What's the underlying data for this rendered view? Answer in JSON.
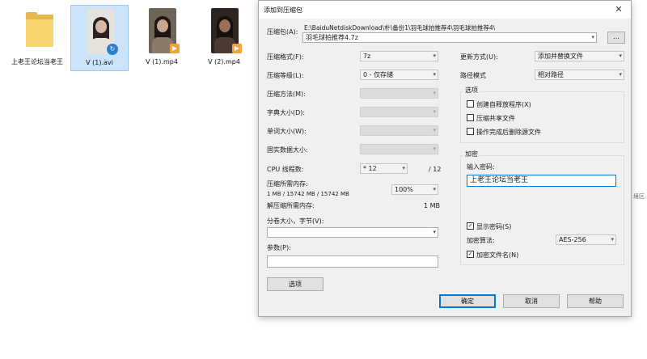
{
  "desktop": {
    "files": [
      {
        "name": "上老王论坛当老王",
        "type": "folder-icon"
      },
      {
        "name": "V (1).avi",
        "type": "video-avi"
      },
      {
        "name": "V (1).mp4",
        "type": "video-mp4"
      },
      {
        "name": "V (2).mp4",
        "type": "video-mp4"
      }
    ],
    "clipped_text": "境区."
  },
  "dialog": {
    "title": "添加到压缩包",
    "archive_label": "压缩包(A):",
    "archive_path": "E:\\BaiduNetdiskDownload\\朴\\备份1\\羽毛球拍推荐4\\羽毛球拍推荐4\\",
    "archive_name": "羽毛球拍推荐4.7z",
    "browse_label": "...",
    "left": {
      "format_label": "压缩格式(F):",
      "format_value": "7z",
      "level_label": "压缩等级(L):",
      "level_value": "0 - 仅存储",
      "method_label": "压缩方法(M):",
      "dict_label": "字典大小(D):",
      "word_label": "单词大小(W):",
      "solid_label": "固实数据大小:",
      "threads_label": "CPU 线程数:",
      "threads_value": "* 12",
      "threads_max": "/ 12",
      "mem_label": "压缩所需内存:",
      "mem_detail": "1 MB / 15742 MB / 15742 MB",
      "mem_value": "100%",
      "decomp_label": "解压缩所需内存:",
      "decomp_value": "1 MB",
      "split_label": "分卷大小，字节(V):",
      "split_value": "",
      "params_label": "参数(P):",
      "params_value": "",
      "options_button": "选项"
    },
    "right": {
      "update_label": "更新方式(U):",
      "update_value": "添加并替换文件",
      "path_label": "路径模式",
      "path_value": "相对路径",
      "options_title": "选项",
      "options": [
        {
          "label": "创建自释放程序(X)",
          "checked": false
        },
        {
          "label": "压缩共享文件",
          "checked": false
        },
        {
          "label": "操作完成后删除源文件",
          "checked": false
        }
      ],
      "encryption_title": "加密",
      "password_label": "输入密码:",
      "password_value": "上老王论坛当老王",
      "show_password_label": "显示密码(S)",
      "show_password_checked": true,
      "algo_label": "加密算法:",
      "algo_value": "AES-256",
      "encrypt_names_label": "加密文件名(N)",
      "encrypt_names_checked": true
    },
    "buttons": {
      "ok": "确定",
      "cancel": "取消",
      "help": "帮助"
    },
    "close_glyph": "✕"
  }
}
